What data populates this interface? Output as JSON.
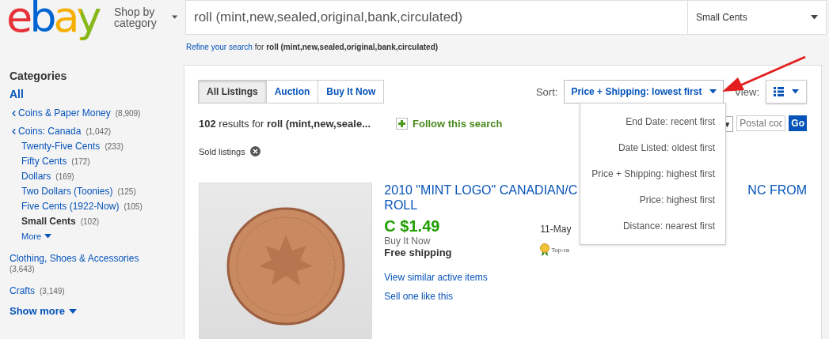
{
  "header": {
    "logo": "ebay",
    "shop_by": "Shop by category",
    "search": {
      "value": "roll (mint,new,sealed,original,bank,circulated)"
    },
    "category_select": "Small Cents"
  },
  "refine": {
    "link": "Refine your search",
    "text": "for **roll (mint,new,sealed,original,bank,circulated)**"
  },
  "sidebar": {
    "heading": "Categories",
    "all": "All",
    "path": [
      {
        "label": "Coins & Paper Money",
        "count": "(8,909)"
      },
      {
        "label": "Coins: Canada",
        "count": "(1,042)",
        "children": [
          {
            "label": "Twenty-Five Cents",
            "count": "(233)",
            "selected": false
          },
          {
            "label": "Fifty Cents",
            "count": "(172)",
            "selected": false
          },
          {
            "label": "Dollars",
            "count": "(169)",
            "selected": false
          },
          {
            "label": "Two Dollars (Toonies)",
            "count": "(125)",
            "selected": false
          },
          {
            "label": "Five Cents (1922-Now)",
            "count": "(105)",
            "selected": false
          },
          {
            "label": "Small Cents",
            "count": "(102)",
            "selected": true
          }
        ]
      }
    ],
    "more": "More",
    "others": [
      {
        "label": "Clothing, Shoes & Accessories",
        "count": "(3,643)"
      },
      {
        "label": "Crafts",
        "count": "(3,149)"
      }
    ],
    "show_more": "Show more"
  },
  "tabs": [
    {
      "label": "All Listings",
      "selected": true
    },
    {
      "label": "Auction",
      "selected": false
    },
    {
      "label": "Buy It Now",
      "selected": false
    }
  ],
  "sort": {
    "label": "Sort:",
    "value": "Price + Shipping: lowest first",
    "expanded": true,
    "options": [
      "End Date: recent first",
      "Date Listed: oldest first",
      "Price + Shipping: highest first",
      "Price: highest first",
      "Distance: nearest first"
    ]
  },
  "view": {
    "label": "View:"
  },
  "results": "**102** results for **roll (mint,new,seale...**",
  "follow": "Follow this search",
  "location": {
    "select_caret": "▼",
    "postal_placeholder": "Postal cod",
    "go": "Go"
  },
  "filter_chip": "Sold listings",
  "listing": {
    "title_start": "2010 \"MINT LOGO\" CANADIAN/C",
    "title_end": "NC FROM",
    "title_line_2": "ROLL",
    "price": "C $1.49",
    "format": "Buy It Now",
    "shipping": "Free shipping",
    "date": "11-May",
    "badge": "Top-ra",
    "links": [
      "View similar active items",
      "Sell one like this"
    ]
  }
}
